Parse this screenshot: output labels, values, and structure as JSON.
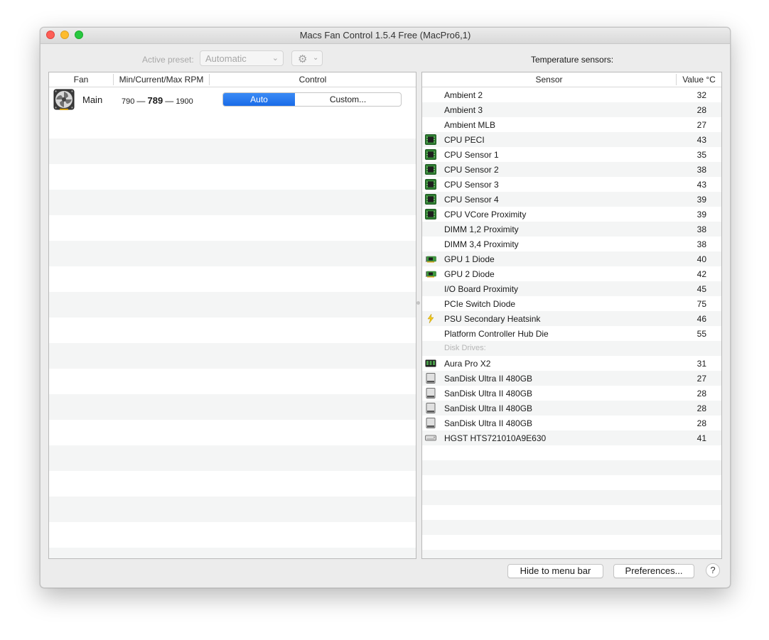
{
  "window": {
    "title": "Macs Fan Control 1.5.4 Free (MacPro6,1)"
  },
  "toolbar": {
    "preset_label": "Active preset:",
    "preset_value": "Automatic",
    "gear_icon": "gear-icon",
    "sensors_heading": "Temperature sensors:"
  },
  "fan_table": {
    "headers": [
      "Fan",
      "Min/Current/Max RPM",
      "Control"
    ],
    "rows": [
      {
        "name": "Main",
        "min": "790",
        "current": "789",
        "max": "1900",
        "separator": "—",
        "control": {
          "selected": "Auto",
          "options": [
            "Auto",
            "Custom..."
          ]
        }
      }
    ]
  },
  "sensor_table": {
    "headers": [
      "Sensor",
      "Value °C"
    ],
    "rows": [
      {
        "name": "Ambient 2",
        "value": "32",
        "icon": "none"
      },
      {
        "name": "Ambient 3",
        "value": "28",
        "icon": "none"
      },
      {
        "name": "Ambient MLB",
        "value": "27",
        "icon": "none"
      },
      {
        "name": "CPU PECI",
        "value": "43",
        "icon": "cpu-chip-icon"
      },
      {
        "name": "CPU Sensor 1",
        "value": "35",
        "icon": "cpu-chip-icon"
      },
      {
        "name": "CPU Sensor 2",
        "value": "38",
        "icon": "cpu-chip-icon"
      },
      {
        "name": "CPU Sensor 3",
        "value": "43",
        "icon": "cpu-chip-icon"
      },
      {
        "name": "CPU Sensor 4",
        "value": "39",
        "icon": "cpu-chip-icon"
      },
      {
        "name": "CPU VCore Proximity",
        "value": "39",
        "icon": "cpu-chip-icon"
      },
      {
        "name": "DIMM 1,2 Proximity",
        "value": "38",
        "icon": "none"
      },
      {
        "name": "DIMM 3,4 Proximity",
        "value": "38",
        "icon": "none"
      },
      {
        "name": "GPU 1 Diode",
        "value": "40",
        "icon": "gpu-card-icon"
      },
      {
        "name": "GPU 2 Diode",
        "value": "42",
        "icon": "gpu-card-icon"
      },
      {
        "name": "I/O Board Proximity",
        "value": "45",
        "icon": "none"
      },
      {
        "name": "PCIe Switch Diode",
        "value": "75",
        "icon": "none"
      },
      {
        "name": "PSU Secondary Heatsink",
        "value": "46",
        "icon": "lightning-icon"
      },
      {
        "name": "Platform Controller Hub Die",
        "value": "55",
        "icon": "none"
      }
    ],
    "disk_section_label": "Disk Drives:",
    "disk_rows": [
      {
        "name": "Aura Pro X2",
        "value": "31",
        "icon": "ssd-module-icon"
      },
      {
        "name": "SanDisk Ultra II 480GB",
        "value": "27",
        "icon": "drive-icon"
      },
      {
        "name": "SanDisk Ultra II 480GB",
        "value": "28",
        "icon": "drive-icon"
      },
      {
        "name": "SanDisk Ultra II 480GB",
        "value": "28",
        "icon": "drive-icon"
      },
      {
        "name": "SanDisk Ultra II 480GB",
        "value": "28",
        "icon": "drive-icon"
      },
      {
        "name": "HGST HTS721010A9E630",
        "value": "41",
        "icon": "hdd-icon"
      }
    ]
  },
  "footer": {
    "hide_label": "Hide to menu bar",
    "prefs_label": "Preferences...",
    "help_label": "?"
  },
  "colors": {
    "accent": "#1a6be8",
    "cpu_icon": "#3f9b3f",
    "lightning": "#e8c21a"
  }
}
